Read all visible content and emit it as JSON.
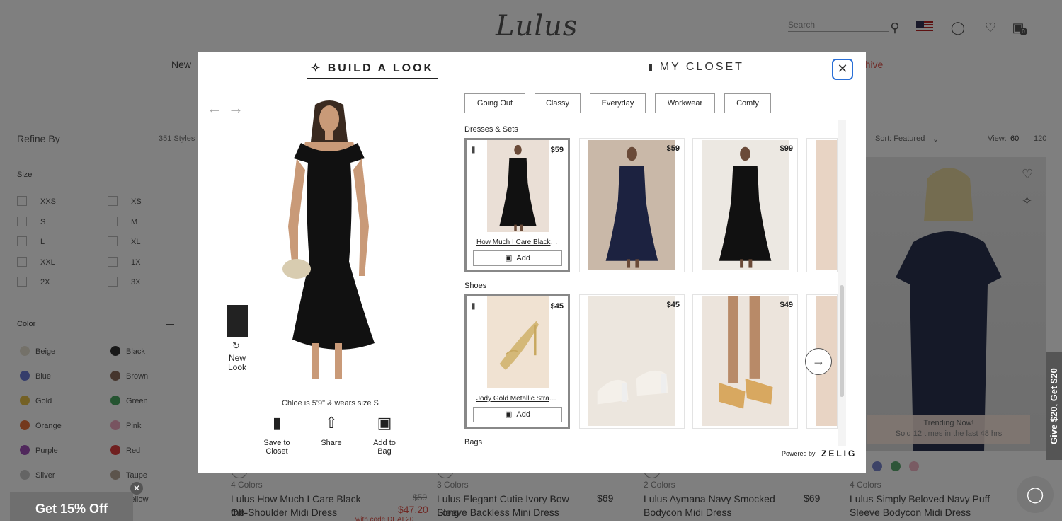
{
  "header": {
    "logo": "Lulus",
    "search_placeholder": "Search",
    "bag_count": "0",
    "nav_new": "New",
    "nav_archive": "rchive"
  },
  "sidebar": {
    "title": "Refine By",
    "styles_count": "351 Styles",
    "size_label": "Size",
    "sizes": [
      "XXS",
      "XS",
      "S",
      "M",
      "L",
      "XL",
      "XXL",
      "1X",
      "2X",
      "3X"
    ],
    "color_label": "Color",
    "colors": [
      {
        "name": "Beige",
        "hex": "#e8e2d2"
      },
      {
        "name": "Black",
        "hex": "#333333"
      },
      {
        "name": "Blue",
        "hex": "#6b7ad6"
      },
      {
        "name": "Brown",
        "hex": "#8a6a5a"
      },
      {
        "name": "Gold",
        "hex": "#e8c24a"
      },
      {
        "name": "Green",
        "hex": "#4aa862"
      },
      {
        "name": "Orange",
        "hex": "#e8733a"
      },
      {
        "name": "Pink",
        "hex": "#f0a8c0"
      },
      {
        "name": "Purple",
        "hex": "#a050b8"
      },
      {
        "name": "Red",
        "hex": "#e04040"
      },
      {
        "name": "Silver",
        "hex": "#c8c8c8"
      },
      {
        "name": "Taupe",
        "hex": "#b8a898"
      }
    ],
    "yellow_label": "Yellow"
  },
  "listing": {
    "sort": "Sort: Featured",
    "view_label": "View:",
    "view_60": "60",
    "view_sep": "|",
    "view_120": "120",
    "trending_title": "Trending Now!",
    "trending_sub": "Sold 12 times in the last 48 hrs",
    "products": [
      {
        "colors": "4 Colors",
        "title1": "Lulus How Much I Care Black Off-",
        "title2": "the-Shoulder Midi Dress",
        "price": "$59",
        "sale": "$47.20",
        "promo": "with code DEAL20"
      },
      {
        "colors": "3 Colors",
        "title1": "Lulus Elegant Cutie Ivory Bow Long",
        "title2": "Sleeve Backless Mini Dress",
        "price": "$69"
      },
      {
        "colors": "2 Colors",
        "title1": "Lulus Aymana Navy Smocked",
        "title2": "Bodycon Midi Dress",
        "price": "$69"
      },
      {
        "colors": "4 Colors",
        "title1": "Lulus Simply Beloved Navy Puff",
        "title2": "Sleeve Bodycon Midi Dress"
      }
    ]
  },
  "modal": {
    "tab_build": "BUILD A LOOK",
    "tab_closet": "MY CLOSET",
    "new_look_1": "New",
    "new_look_2": "Look",
    "caption": "Chloe is 5'9\" & wears size S",
    "save_1": "Save to",
    "save_2": "Closet",
    "share": "Share",
    "add_1": "Add to",
    "add_2": "Bag",
    "filters": [
      "Going Out",
      "Classy",
      "Everyday",
      "Workwear",
      "Comfy"
    ],
    "cat_dresses": "Dresses & Sets",
    "cat_shoes": "Shoes",
    "cat_bags": "Bags",
    "dresses": [
      {
        "price": "$59",
        "name": "How Much I Care Black Off-the-Shoulder Midi Dress",
        "add": "Add"
      },
      {
        "price": "$59"
      },
      {
        "price": "$99"
      }
    ],
    "shoes": [
      {
        "price": "$45",
        "name": "Jody Gold Metallic Strappy Heels",
        "add": "Add"
      },
      {
        "price": "$45"
      },
      {
        "price": "$49"
      }
    ],
    "powered_by": "Powered by",
    "zelig": "ZELIG"
  },
  "promos": {
    "bottom": "Get 15% Off",
    "side": "Give $20, Get $20"
  }
}
